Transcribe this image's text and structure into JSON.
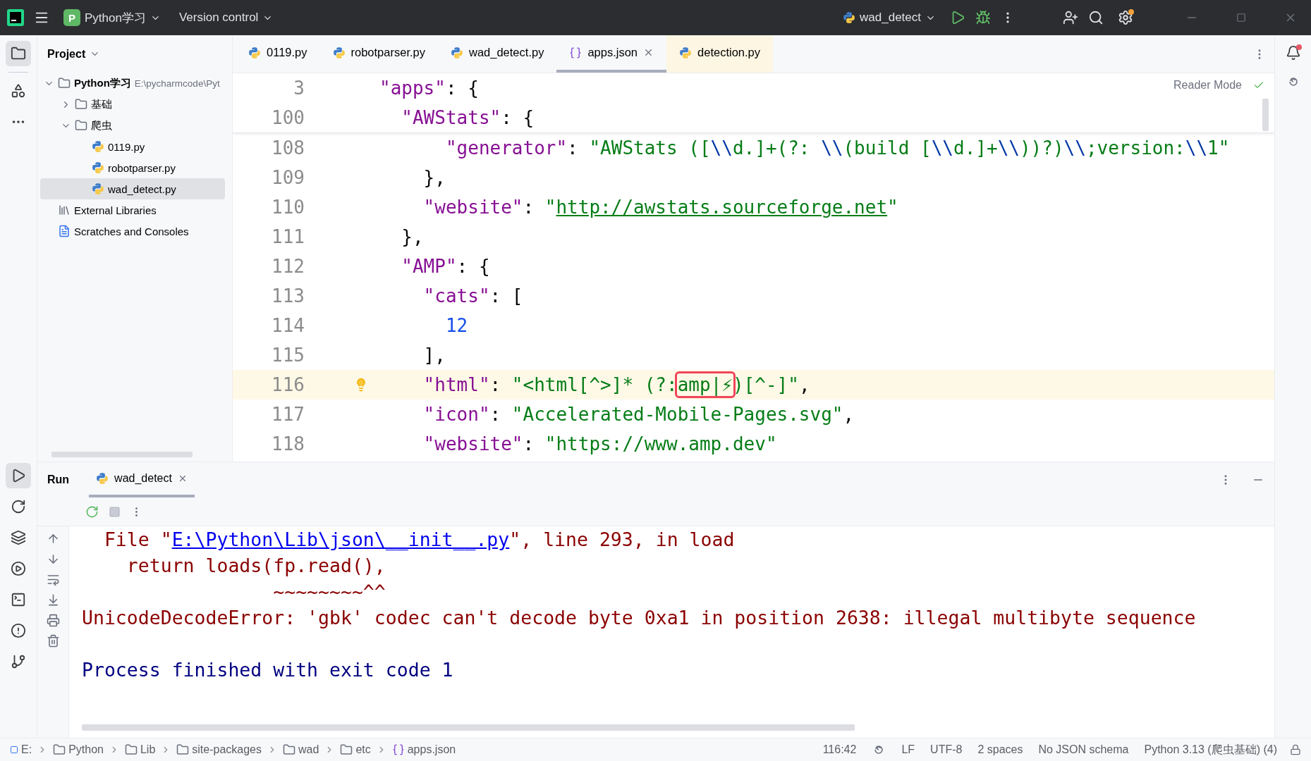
{
  "title_bar": {
    "project_letter": "P",
    "project": "Python学习",
    "vcs": "Version control",
    "run_config": "wad_detect"
  },
  "project_panel": {
    "title": "Project",
    "tree": [
      {
        "label": "Python学习",
        "path": "E:\\pycharmcode\\Pyt",
        "kind": "folder",
        "expanded": true,
        "selected": false,
        "children": [
          {
            "label": "基础",
            "kind": "folder",
            "expanded": false,
            "selected": false
          },
          {
            "label": "爬虫",
            "kind": "folder",
            "expanded": true,
            "selected": false,
            "children": [
              {
                "label": "0119.py",
                "kind": "python",
                "selected": false
              },
              {
                "label": "robotparser.py",
                "kind": "python",
                "selected": false
              },
              {
                "label": "wad_detect.py",
                "kind": "python",
                "selected": true
              }
            ]
          }
        ]
      },
      {
        "label": "External Libraries",
        "kind": "library",
        "selected": false
      },
      {
        "label": "Scratches and Consoles",
        "kind": "scratches",
        "selected": false
      }
    ]
  },
  "editor": {
    "tabs": [
      {
        "label": "0119.py",
        "kind": "python",
        "selected": false,
        "closable": false,
        "tinted": false
      },
      {
        "label": "robotparser.py",
        "kind": "python",
        "selected": false,
        "closable": false,
        "tinted": false
      },
      {
        "label": "wad_detect.py",
        "kind": "python",
        "selected": false,
        "closable": false,
        "tinted": false
      },
      {
        "label": "apps.json",
        "kind": "json",
        "selected": true,
        "closable": true,
        "tinted": false
      },
      {
        "label": "detection.py",
        "kind": "python",
        "selected": false,
        "closable": false,
        "tinted": true
      }
    ],
    "reader_mode": "Reader Mode",
    "sticky_lines": [
      {
        "number": "3",
        "current": false,
        "tokens": [
          {
            "text": "\"apps\"",
            "kind": "key"
          },
          {
            "text": ": {",
            "kind": "punct"
          }
        ]
      },
      {
        "number": "100",
        "current": false,
        "tokens": [
          {
            "text": "  \"AWStats\"",
            "kind": "key"
          },
          {
            "text": ": {",
            "kind": "punct"
          }
        ]
      }
    ],
    "lines": [
      {
        "number": "108",
        "current": false,
        "tokens": [
          {
            "text": "      \"generator\"",
            "kind": "key"
          },
          {
            "text": ": ",
            "kind": "punct"
          },
          {
            "text": "\"AWStats ([",
            "kind": "string"
          },
          {
            "text": "\\\\",
            "kind": "escape"
          },
          {
            "text": "d.]+(?: ",
            "kind": "string"
          },
          {
            "text": "\\\\",
            "kind": "escape"
          },
          {
            "text": "(build [",
            "kind": "string"
          },
          {
            "text": "\\\\",
            "kind": "escape"
          },
          {
            "text": "d.]+",
            "kind": "string"
          },
          {
            "text": "\\\\",
            "kind": "escape"
          },
          {
            "text": "))?)",
            "kind": "string"
          },
          {
            "text": "\\\\",
            "kind": "escape"
          },
          {
            "text": ";version:",
            "kind": "string"
          },
          {
            "text": "\\\\",
            "kind": "escape"
          },
          {
            "text": "1\"",
            "kind": "string"
          }
        ]
      },
      {
        "number": "109",
        "current": false,
        "tokens": [
          {
            "text": "    },",
            "kind": "punct"
          }
        ]
      },
      {
        "number": "110",
        "current": false,
        "tokens": [
          {
            "text": "    \"website\"",
            "kind": "key"
          },
          {
            "text": ": ",
            "kind": "punct"
          },
          {
            "text": "\"",
            "kind": "string"
          },
          {
            "text": "http://awstats.sourceforge.net",
            "kind": "url"
          },
          {
            "text": "\"",
            "kind": "string"
          }
        ]
      },
      {
        "number": "111",
        "current": false,
        "tokens": [
          {
            "text": "  },",
            "kind": "punct"
          }
        ]
      },
      {
        "number": "112",
        "current": false,
        "tokens": [
          {
            "text": "  \"AMP\"",
            "kind": "key"
          },
          {
            "text": ": {",
            "kind": "punct"
          }
        ]
      },
      {
        "number": "113",
        "current": false,
        "tokens": [
          {
            "text": "    \"cats\"",
            "kind": "key"
          },
          {
            "text": ": [",
            "kind": "punct"
          }
        ]
      },
      {
        "number": "114",
        "current": false,
        "tokens": [
          {
            "text": "      12",
            "kind": "number"
          }
        ]
      },
      {
        "number": "115",
        "current": false,
        "tokens": [
          {
            "text": "    ],",
            "kind": "punct"
          }
        ]
      },
      {
        "number": "116",
        "current": true,
        "tokens": [
          {
            "text": "    \"html\"",
            "kind": "key"
          },
          {
            "text": ": ",
            "kind": "punct"
          },
          {
            "text": "\"<html[^>]* (?:",
            "kind": "string"
          },
          {
            "text": "amp|⚡",
            "kind": "marked"
          },
          {
            "text": ")[^-]\"",
            "kind": "string"
          },
          {
            "text": ",",
            "kind": "punct"
          }
        ]
      },
      {
        "number": "117",
        "current": false,
        "tokens": [
          {
            "text": "    \"icon\"",
            "kind": "key"
          },
          {
            "text": ": ",
            "kind": "punct"
          },
          {
            "text": "\"Accelerated-Mobile-Pages.svg\"",
            "kind": "string"
          },
          {
            "text": ",",
            "kind": "punct"
          }
        ]
      },
      {
        "number": "118",
        "current": false,
        "tokens": [
          {
            "text": "    \"website\"",
            "kind": "key"
          },
          {
            "text": ": ",
            "kind": "punct"
          },
          {
            "text": "\"https://www.amp.dev\"",
            "kind": "string"
          }
        ]
      }
    ]
  },
  "run_panel": {
    "title": "Run",
    "tab": "wad_detect",
    "console": [
      {
        "kind": "error",
        "segments": [
          {
            "text": "  File \"",
            "link": false
          },
          {
            "text": "E:\\Python\\Lib\\json\\__init__.py",
            "link": true
          },
          {
            "text": "\", line 293, in load",
            "link": false
          }
        ]
      },
      {
        "kind": "error",
        "segments": [
          {
            "text": "    return loads(fp.read(),",
            "link": false
          }
        ]
      },
      {
        "kind": "error",
        "segments": [
          {
            "text": "                 ~~~~~~~~^^",
            "link": false
          }
        ]
      },
      {
        "kind": "error",
        "segments": [
          {
            "text": "UnicodeDecodeError: 'gbk' codec can't decode byte 0xa1 in position 2638: illegal multibyte sequence",
            "link": false
          }
        ]
      },
      {
        "kind": "exit",
        "segments": [
          {
            "text": "Process finished with exit code 1",
            "link": false
          }
        ]
      }
    ]
  },
  "status_bar": {
    "breadcrumb": [
      {
        "label": "E:",
        "kind": "drive"
      },
      {
        "label": "Python",
        "kind": "folder"
      },
      {
        "label": "Lib",
        "kind": "folder"
      },
      {
        "label": "site-packages",
        "kind": "folder"
      },
      {
        "label": "wad",
        "kind": "folder"
      },
      {
        "label": "etc",
        "kind": "folder"
      },
      {
        "label": "apps.json",
        "kind": "json"
      }
    ],
    "position": "116:42",
    "line_ending": "LF",
    "encoding": "UTF-8",
    "indent": "2 spaces",
    "schema": "No JSON schema",
    "interpreter": "Python 3.13 (爬虫基础) (4)"
  }
}
